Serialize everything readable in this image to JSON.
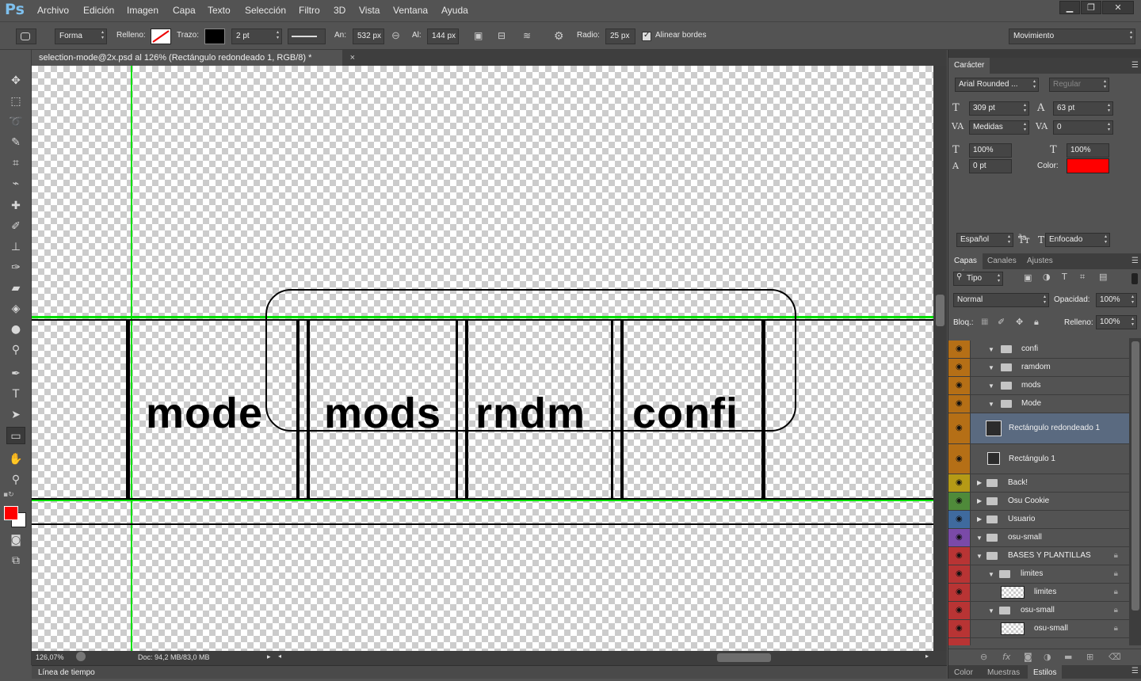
{
  "app": {
    "logo": "Ps"
  },
  "menu": [
    "Archivo",
    "Edición",
    "Imagen",
    "Capa",
    "Texto",
    "Selección",
    "Filtro",
    "3D",
    "Vista",
    "Ventana",
    "Ayuda"
  ],
  "window_buttons": {
    "minimize": "▁",
    "restore": "❐",
    "close": "✕"
  },
  "options": {
    "mode": "Forma",
    "fill_label": "Relleno:",
    "stroke_label": "Trazo:",
    "stroke_width": "2 pt",
    "width_label": "An:",
    "width_value": "532 px",
    "height_label": "Al:",
    "height_value": "144 px",
    "radius_label": "Radio:",
    "radius_value": "25 px",
    "align_edges": "Alinear bordes",
    "workspace": "Movimiento"
  },
  "document": {
    "tab_title": "selection-mode@2x.psd al 126% (Rectángulo redondeado 1, RGB/8) *",
    "close": "×"
  },
  "canvas": {
    "words": [
      "mode",
      "mods",
      "rndm",
      "confi"
    ]
  },
  "status": {
    "zoom": "126,07%",
    "doc": "Doc: 94,2 MB/83,0 MB"
  },
  "timeline": {
    "label": "Línea de tiempo"
  },
  "character": {
    "tab": "Carácter",
    "font": "Arial Rounded ...",
    "style": "Regular",
    "size": "309 pt",
    "leading": "63 pt",
    "kerning": "Medidas",
    "tracking": "0",
    "vscale": "100%",
    "hscale": "100%",
    "baseline": "0 pt",
    "color_label": "Color:",
    "color_value": "#ff0000",
    "language": "Español",
    "antialias": "Enfocado"
  },
  "layers_panel": {
    "tabs": [
      "Capas",
      "Canales",
      "Ajustes"
    ],
    "filter": "Tipo",
    "blend": "Normal",
    "opacity_label": "Opacidad:",
    "opacity": "100%",
    "lock_label": "Bloq.:",
    "fill_label": "Relleno:",
    "fill": "100%",
    "layers": [
      {
        "name": "confi",
        "color": "#b56f16"
      },
      {
        "name": "ramdom",
        "color": "#b56f16"
      },
      {
        "name": "mods",
        "color": "#b56f16"
      },
      {
        "name": "Mode",
        "color": "#b56f16"
      },
      {
        "name": "Rectángulo redondeado 1",
        "color": "#b56f16"
      },
      {
        "name": "Rectángulo 1",
        "color": "#b56f16"
      },
      {
        "name": "Back!",
        "color": "#b59a16"
      },
      {
        "name": "Osu Cookie",
        "color": "#4f8a3a"
      },
      {
        "name": "Usuario",
        "color": "#3f6a9e"
      },
      {
        "name": "osu-small",
        "color": "#7a4aa8"
      },
      {
        "name": "BASES Y PLANTILLAS",
        "color": "#b83434"
      },
      {
        "name": "limites",
        "color": "#b83434"
      },
      {
        "name": "limites",
        "color": "#b83434"
      },
      {
        "name": "osu-small",
        "color": "#b83434"
      },
      {
        "name": "osu-small",
        "color": "#b83434"
      }
    ]
  },
  "bottom_tabs": [
    "Color",
    "Muestras",
    "Estilos"
  ]
}
